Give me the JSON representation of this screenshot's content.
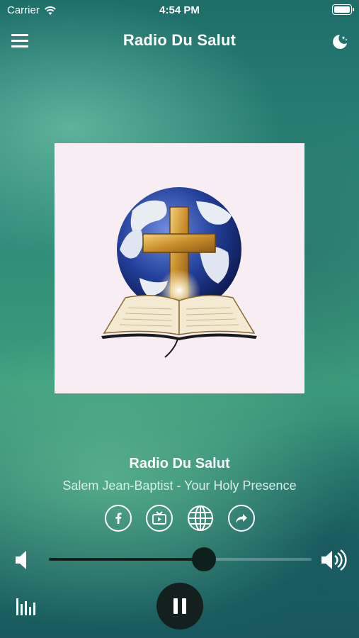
{
  "status_bar": {
    "carrier": "Carrier",
    "time": "4:54 PM"
  },
  "nav": {
    "title": "Radio Du Salut",
    "menu_icon": "hamburger-menu-icon",
    "night_icon": "moon-stars-icon"
  },
  "artwork": {
    "description_icon": "globe-cross-bible-logo"
  },
  "now_playing": {
    "station": "Radio Du Salut",
    "track": "Salem Jean-Baptist - Your Holy Presence"
  },
  "social": [
    {
      "icon": "facebook-icon"
    },
    {
      "icon": "tv-icon"
    },
    {
      "icon": "globe-icon"
    },
    {
      "icon": "share-icon"
    }
  ],
  "volume": {
    "level": 0.59
  },
  "controls": {
    "state": "playing",
    "play_pause_icon": "pause-icon",
    "equalizer_icon": "equalizer-icon"
  },
  "colors": {
    "accent": "#0f1f1c",
    "artwork_bg": "#f7edf3"
  }
}
